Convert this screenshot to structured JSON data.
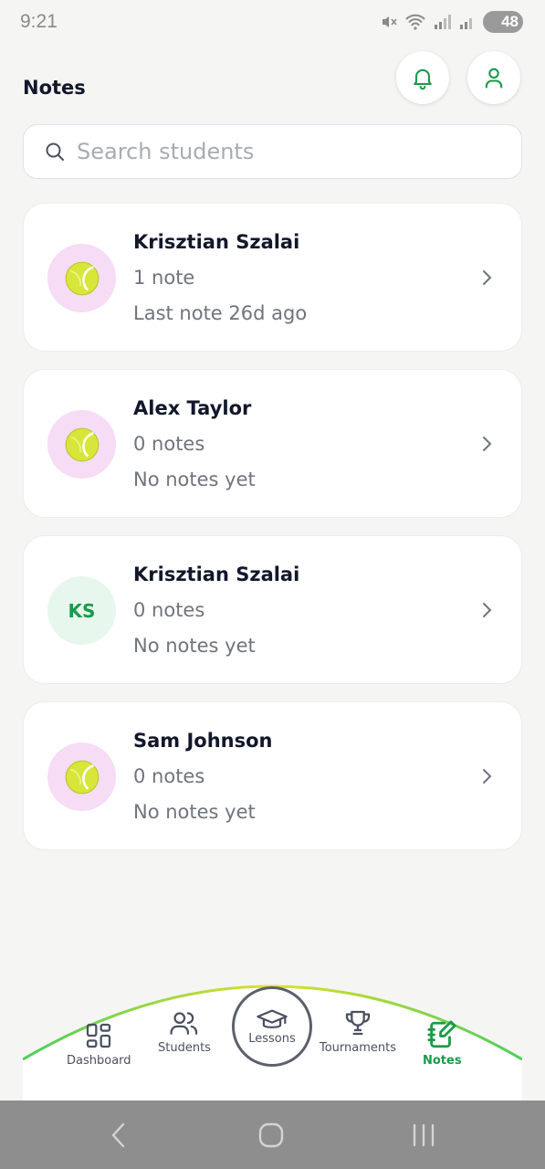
{
  "status_bar": {
    "time": "9:21",
    "battery": "48"
  },
  "header": {
    "title": "Notes"
  },
  "search": {
    "placeholder": "Search students"
  },
  "students": [
    {
      "name": "Krisztian Szalai",
      "count": "1 note",
      "last": "Last note 26d ago",
      "avatar": "tennis-ball"
    },
    {
      "name": "Alex Taylor",
      "count": "0 notes",
      "last": "No notes yet",
      "avatar": "tennis-ball"
    },
    {
      "name": "Krisztian Szalai",
      "count": "0 notes",
      "last": "No notes yet",
      "avatar": "KS"
    },
    {
      "name": "Sam Johnson",
      "count": "0 notes",
      "last": "No notes yet",
      "avatar": "tennis-ball"
    }
  ],
  "bottom_nav": {
    "dashboard": "Dashboard",
    "students": "Students",
    "lessons": "Lessons",
    "tournaments": "Tournaments",
    "notes": "Notes",
    "active": "notes"
  },
  "colors": {
    "accent": "#1a9b4a",
    "avatar_ball_bg": "#f6dcf5",
    "avatar_initials_bg": "#e8f7ee"
  }
}
